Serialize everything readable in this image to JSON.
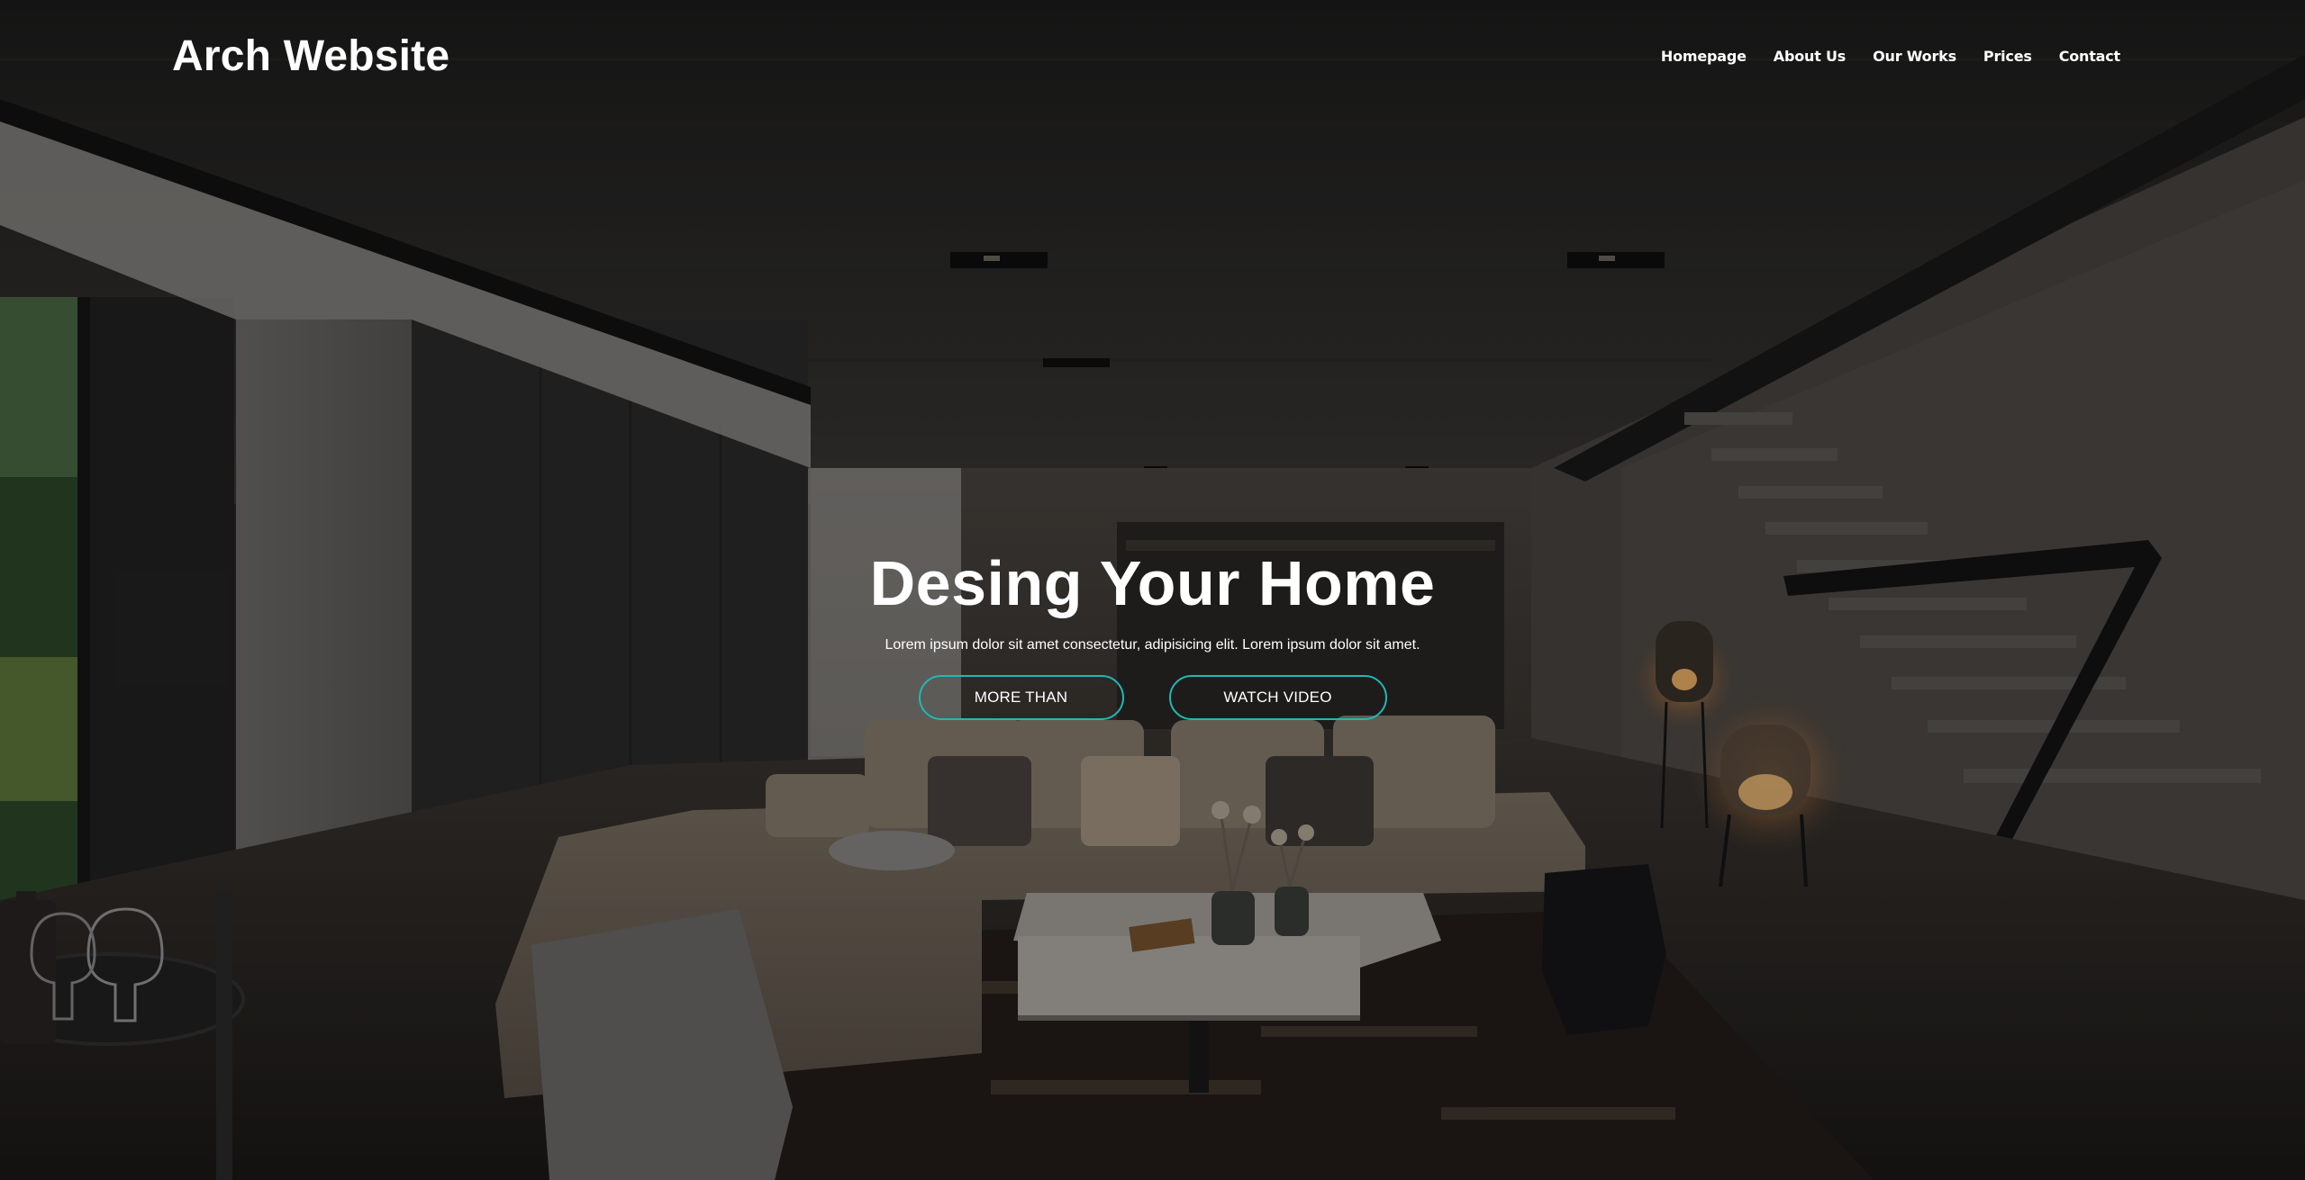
{
  "site": {
    "logo": "Arch Website"
  },
  "nav": {
    "items": [
      {
        "label": "Homepage"
      },
      {
        "label": "About Us"
      },
      {
        "label": "Our Works"
      },
      {
        "label": "Prices"
      },
      {
        "label": "Contact"
      }
    ]
  },
  "hero": {
    "title": "Desing Your Home",
    "subtitle": "Lorem ipsum dolor sit amet consectetur, adipisicing elit. Lorem ipsum dolor sit amet.",
    "buttons": {
      "more_label": "MORE THAN",
      "video_label": "WATCH VIDEO"
    },
    "accent_color": "#1fb9b5"
  }
}
